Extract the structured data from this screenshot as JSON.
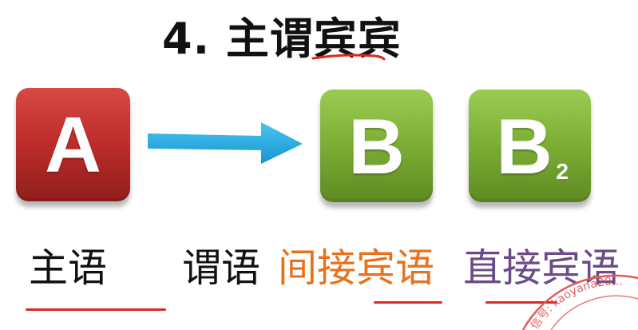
{
  "title": "4. 主谓宾宾",
  "boxes": {
    "a": {
      "letter": "A"
    },
    "b": {
      "letter": "B"
    },
    "b2": {
      "letter": "B",
      "subscript": "2"
    }
  },
  "labels": {
    "subject": "主语",
    "predicate": "谓语",
    "indirect_object": "间接宾语",
    "direct_object": "直接宾语"
  },
  "watermark": {
    "text": "信号: kaoyana20..."
  },
  "colors": {
    "red_box": "#c0302d",
    "green_box": "#7fb036",
    "arrow": "#20a9e0",
    "indirect_object_label": "#e8711c",
    "direct_object_label": "#6b4b86",
    "underline": "#e0271f",
    "watermark": "#e05a5a"
  }
}
